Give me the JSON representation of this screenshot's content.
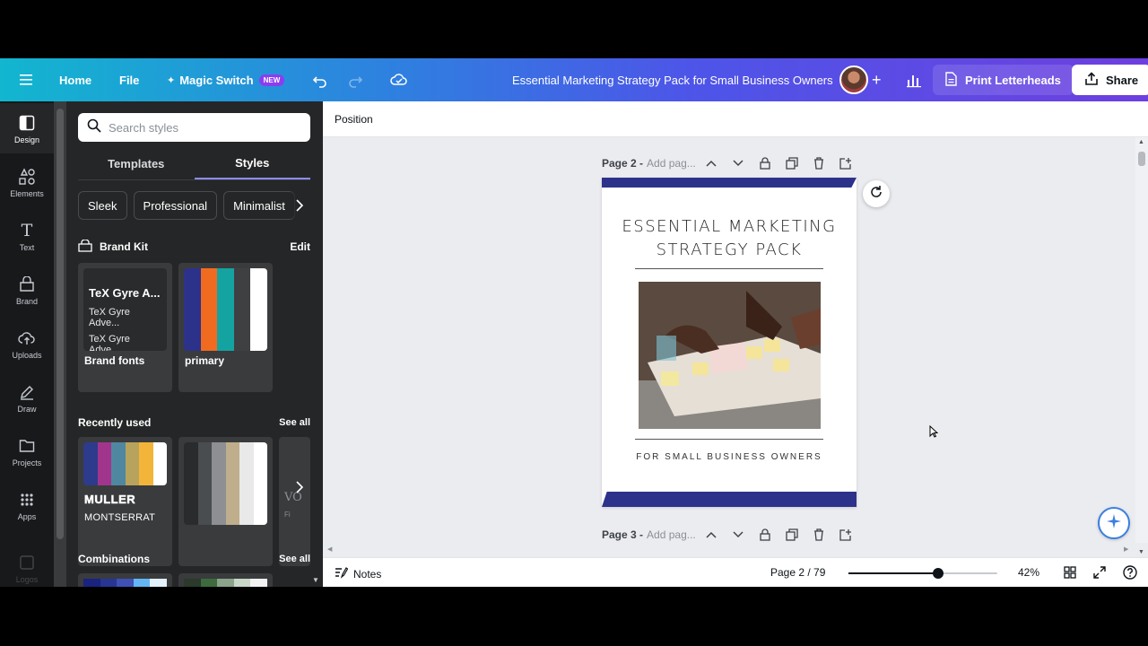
{
  "topbar": {
    "home": "Home",
    "file": "File",
    "magic_switch": "Magic Switch",
    "new_badge": "NEW",
    "doc_title": "Essential Marketing Strategy Pack for Small Business Owners",
    "print": "Print Letterheads",
    "share": "Share"
  },
  "rail": {
    "design": "Design",
    "elements": "Elements",
    "text": "Text",
    "brand": "Brand",
    "uploads": "Uploads",
    "draw": "Draw",
    "projects": "Projects",
    "apps": "Apps",
    "logos": "Logos"
  },
  "panel": {
    "search_placeholder": "Search styles",
    "tabs": {
      "templates": "Templates",
      "styles": "Styles"
    },
    "chips": [
      "Sleek",
      "Professional",
      "Minimalist"
    ],
    "brand_kit": {
      "title": "Brand Kit",
      "action": "Edit"
    },
    "brand_fonts": {
      "label": "Brand fonts",
      "font1": "TeX Gyre A...",
      "font2": "TeX Gyre Adve...",
      "font3": "TeX Gyre Adve..."
    },
    "primary": {
      "label": "primary",
      "colors": [
        "#2c328a",
        "#f06b1f",
        "#14a3a0",
        "#3f4042",
        "#ffffff"
      ]
    },
    "recently_used": {
      "title": "Recently used",
      "action": "See all",
      "card1": {
        "colors": [
          "#2e3a8c",
          "#a1358c",
          "#4f87a0",
          "#b8a35c",
          "#f2b53a",
          "#ffffff"
        ],
        "font_a": "MULLER",
        "font_b": "MONTSERRAT"
      },
      "card2": {
        "colors": [
          "#2a2b2d",
          "#4a4d50",
          "#8d8f92",
          "#bfae8c",
          "#e9e9e9",
          "#ffffff"
        ]
      },
      "card3_peek": {
        "font_a": "VO",
        "font_b": "Fi"
      }
    },
    "combinations": {
      "title": "Combinations",
      "action": "See all"
    }
  },
  "editor": {
    "context_label": "Position",
    "page2": {
      "label": "Page 2 -",
      "placeholder": "Add pag..."
    },
    "page3": {
      "label": "Page 3 -",
      "placeholder": "Add pag..."
    },
    "design": {
      "title_line1": "ESSENTIAL MARKETING",
      "title_line2": "STRATEGY PACK",
      "subtitle": "FOR SMALL BUSINESS OWNERS",
      "band_color": "#2c328a"
    },
    "footer": {
      "notes": "Notes",
      "page_indicator": "Page 2 / 79",
      "zoom": "42%",
      "zoom_level": 0.42
    }
  }
}
